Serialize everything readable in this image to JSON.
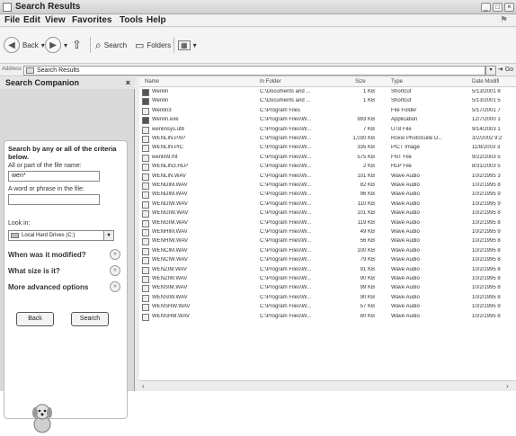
{
  "window": {
    "title": "Search Results"
  },
  "menu": [
    "File",
    "Edit",
    "View",
    "Favorites",
    "Tools",
    "Help"
  ],
  "toolbar": {
    "back": "Back",
    "search": "Search",
    "folders": "Folders",
    "views_icon": "views-icon"
  },
  "address": {
    "label": "Address",
    "value": "Search Results",
    "go": "Go"
  },
  "sidebar": {
    "title": "Search Companion",
    "criteria_title": "Search by any or all of the criteria below.",
    "name_label": "All or part of the file name:",
    "name_value": "wen*",
    "phrase_label": "A word or phrase in the file:",
    "phrase_value": "",
    "lookin_label": "Look in:",
    "lookin_value": "Local Hard Drives (C:)",
    "options": [
      "When was it modified?",
      "What size is it?",
      "More advanced options"
    ],
    "back_label": "Back",
    "search_label": "Search"
  },
  "columns": [
    "Name",
    "In Folder",
    "Size",
    "Type",
    "Date Modifi"
  ],
  "rows": [
    {
      "name": "Wenlin",
      "folder": "C:\\Documents and ...",
      "size": "1 KB",
      "type": "Shortcut",
      "date": "5/13/2001 8",
      "icon": "black"
    },
    {
      "name": "Wenlin",
      "folder": "C:\\Documents and ...",
      "size": "1 KB",
      "type": "Shortcut",
      "date": "5/13/2001 5",
      "icon": "black"
    },
    {
      "name": "Wenlin3",
      "folder": "C:\\Program Files",
      "size": "",
      "type": "File Folder",
      "date": "5/17/2001 7",
      "icon": "folder"
    },
    {
      "name": "Wenlin.exe",
      "folder": "C:\\Program Files\\W...",
      "size": "993 KB",
      "type": "Application",
      "date": "12/7/2000 1",
      "icon": "black"
    },
    {
      "name": "wenlinsys.ut8",
      "folder": "C:\\Program Files\\W...",
      "size": "7 KB",
      "type": "UT8 File",
      "date": "9/14/2003 1",
      "icon": "doc"
    },
    {
      "name": "WENLIN.PXP",
      "folder": "C:\\Program Files\\W...",
      "size": "1,030 KB",
      "type": "Roxio PhotoSuite D...",
      "date": "3/2/2002 9:2",
      "icon": "doc"
    },
    {
      "name": "WENLIN.PIC",
      "folder": "C:\\Program Files\\W...",
      "size": "335 KB",
      "type": "PICT Image",
      "date": "11/8/2003 3",
      "icon": "doc"
    },
    {
      "name": "wenlin9.fnt",
      "folder": "C:\\Program Files\\W...",
      "size": "575 KB",
      "type": "FNT File",
      "date": "9/22/2003 5",
      "icon": "doc"
    },
    {
      "name": "WENLIN3.HLP",
      "folder": "C:\\Program Files\\W...",
      "size": "2 KB",
      "type": "HLP File",
      "date": "8/31/2003 5",
      "icon": "doc"
    },
    {
      "name": "WENLIN.WAV",
      "folder": "C:\\Program Files\\W...",
      "size": "101 KB",
      "type": "Wave Audio",
      "date": "10/2/1995 3",
      "icon": "doc"
    },
    {
      "name": "WENDIM.WAV",
      "folder": "C:\\Program Files\\W...",
      "size": "82 KB",
      "type": "Wave Audio",
      "date": "10/2/1995 8",
      "icon": "doc"
    },
    {
      "name": "WENDIM.WAV",
      "folder": "C:\\Program Files\\W...",
      "size": "96 KB",
      "type": "Wave Audio",
      "date": "10/2/1995 9",
      "icon": "doc"
    },
    {
      "name": "WENDIW.WAV",
      "folder": "C:\\Program Files\\W...",
      "size": "110 KB",
      "type": "Wave Audio",
      "date": "10/2/1995 9",
      "icon": "doc"
    },
    {
      "name": "WENGIW.WAV",
      "folder": "C:\\Program Files\\W...",
      "size": "101 KB",
      "type": "Wave Audio",
      "date": "10/2/1995 8",
      "icon": "doc"
    },
    {
      "name": "WENGIM.WAV",
      "folder": "C:\\Program Files\\W...",
      "size": "119 KB",
      "type": "Wave Audio",
      "date": "10/2/1995 8",
      "icon": "doc"
    },
    {
      "name": "WENHIM.WAV",
      "folder": "C:\\Program Files\\W...",
      "size": "49 KB",
      "type": "Wave Audio",
      "date": "10/2/1995 9",
      "icon": "doc"
    },
    {
      "name": "WENHIW.WAV",
      "folder": "C:\\Program Files\\W...",
      "size": "56 KB",
      "type": "Wave Audio",
      "date": "10/2/1995 8",
      "icon": "doc"
    },
    {
      "name": "WENCIM.WAV",
      "folder": "C:\\Program Files\\W...",
      "size": "100 KB",
      "type": "Wave Audio",
      "date": "10/2/1995 8",
      "icon": "doc"
    },
    {
      "name": "WENCIW.WAV",
      "folder": "C:\\Program Files\\W...",
      "size": "79 KB",
      "type": "Wave Audio",
      "date": "10/2/1995 8",
      "icon": "doc"
    },
    {
      "name": "WENZIM.WAV",
      "folder": "C:\\Program Files\\W...",
      "size": "91 KB",
      "type": "Wave Audio",
      "date": "10/2/1995 8",
      "icon": "doc"
    },
    {
      "name": "WENZIW.WAV",
      "folder": "C:\\Program Files\\W...",
      "size": "90 KB",
      "type": "Wave Audio",
      "date": "10/2/1995 8",
      "icon": "doc"
    },
    {
      "name": "WENSIM.WAV",
      "folder": "C:\\Program Files\\W...",
      "size": "99 KB",
      "type": "Wave Audio",
      "date": "10/2/1995 8",
      "icon": "doc"
    },
    {
      "name": "WENSIW.WAV",
      "folder": "C:\\Program Files\\W...",
      "size": "90 KB",
      "type": "Wave Audio",
      "date": "10/2/1995 8",
      "icon": "doc"
    },
    {
      "name": "WENSHW.WAV",
      "folder": "C:\\Program Files\\W...",
      "size": "57 KB",
      "type": "Wave Audio",
      "date": "10/2/1995 9",
      "icon": "doc"
    },
    {
      "name": "WENSHM.WAV",
      "folder": "C:\\Program Files\\W...",
      "size": "80 KB",
      "type": "Wave Audio",
      "date": "10/2/1995 8",
      "icon": "doc"
    }
  ]
}
